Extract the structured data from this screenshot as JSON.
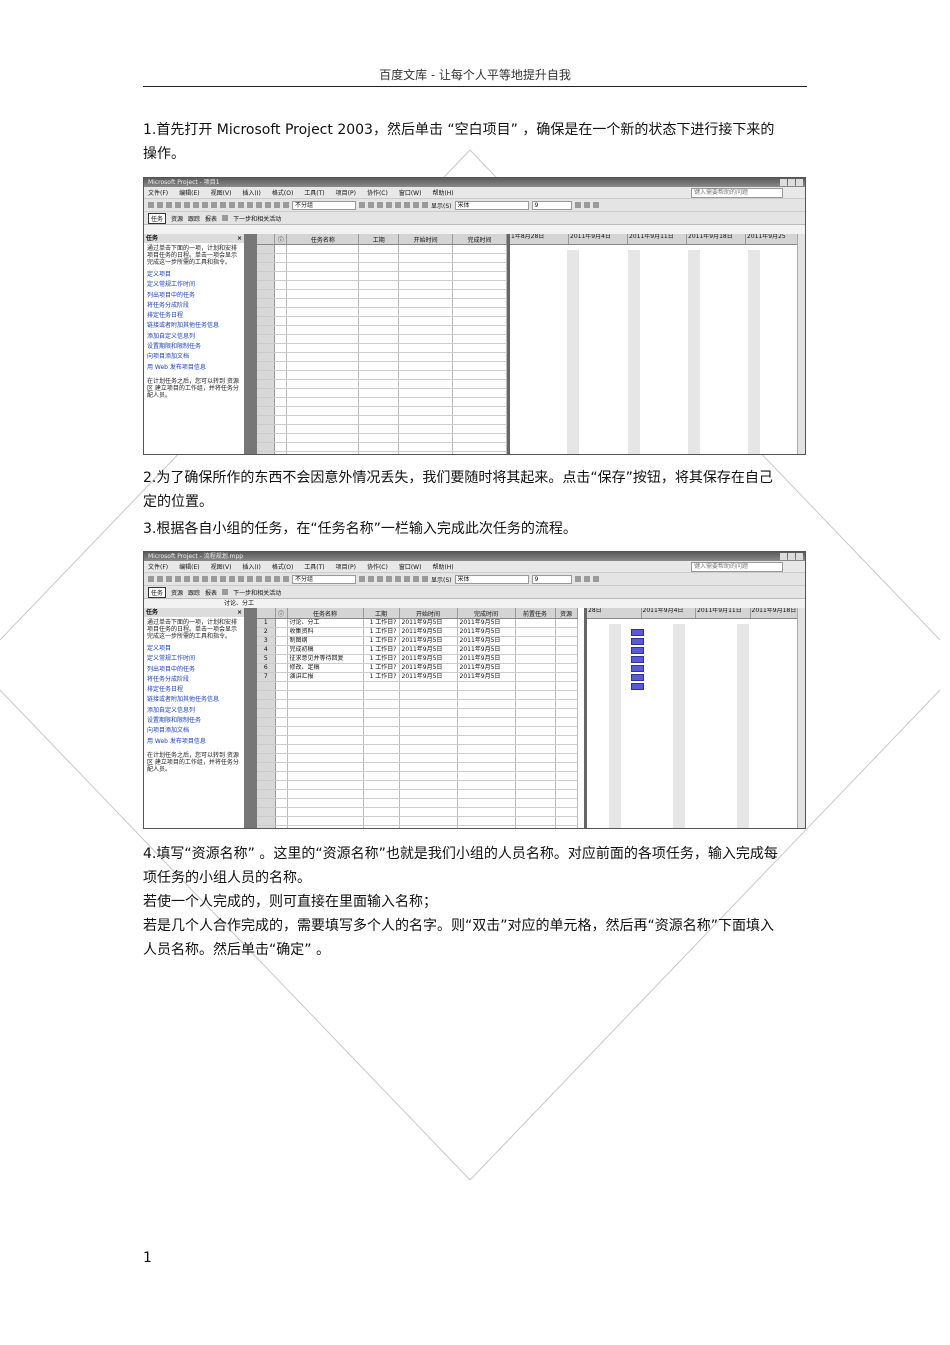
{
  "header": {
    "text": "百度文库  - 让每个人平等地提升自我"
  },
  "paragraphs": {
    "p1": "1.首先打开   Microsoft Project 2003，然后单击 “空白项目” ，确保是在一个新的状态下进行接下来的操作。",
    "p2": "2.为了确保所作的东西不会因意外情况丢失，我们要随时将其起来。点击“保存”按钮，将其保存在自己定的位置。",
    "p3": "3.根据各自小组的任务，在“任务名称”一栏输入完成此次任务的流程。",
    "p4": "4.填写“资源名称”  。这里的“资源名称”也就是我们小组的人员名称。对应前面的各项任务，输入完成每项任务的小组人员的名称。",
    "p5": "若使一个人完成的，则可直接在里面输入名称；",
    "p6": "若是几个人合作完成的，需要填写多个人的名字。则“双击”对应的单元格，然后再“资源名称”下面填入人员名称。然后单击“确定”    。"
  },
  "page_number": "1",
  "shot1": {
    "title": "Microsoft Project - 项目1",
    "menus": [
      "文件(F)",
      "编辑(E)",
      "视图(V)",
      "插入(I)",
      "格式(O)",
      "工具(T)",
      "项目(P)",
      "协作(C)",
      "窗口(W)",
      "帮助(H)"
    ],
    "help_placeholder": "键入需要帮助的问题",
    "group_combo": "不分组",
    "show_label": "显示(S)",
    "font_combo": "宋体",
    "size_combo": "9",
    "subbar": [
      "任务",
      "资源",
      "跟踪",
      "报表"
    ],
    "next_steps": "下一步和相关活动",
    "pane_title": "任务",
    "pane_intro": "通过单击下面的一项，计划和安排项目任务的日程。单击一项会显示完成这一步所需的工具和指令。",
    "pane_links": [
      "定义项目",
      "定义常规工作时间",
      "列出项目中的任务",
      "将任务分成阶段",
      "排定任务日程",
      "链接或者附加其他任务信息",
      "添加自定义信息列",
      "设置期限和限制任务",
      "向项目添加文档",
      "用 Web 发布项目信息"
    ],
    "pane_foot": "在计划任务之后，您可以转到 资源区 建立项目的工作组，并将任务分配人员。",
    "columns": [
      "任务名称",
      "工期",
      "开始时间",
      "完成时间"
    ],
    "gantt_weeks": [
      "1年8月28日",
      "2011年9月4日",
      "2011年9月11日",
      "2011年9月18日",
      "2011年9月25"
    ]
  },
  "shot2": {
    "title": "Microsoft Project - 流程规划.mpp",
    "menus": [
      "文件(F)",
      "编辑(E)",
      "视图(V)",
      "插入(I)",
      "格式(O)",
      "工具(T)",
      "项目(P)",
      "协作(C)",
      "窗口(W)",
      "帮助(H)"
    ],
    "help_placeholder": "键入需要帮助的问题",
    "group_combo": "不分组",
    "show_label": "显示(S)",
    "font_combo": "宋体",
    "size_combo": "9",
    "subbar": [
      "任务",
      "资源",
      "跟踪",
      "报表"
    ],
    "next_steps": "下一步和相关活动",
    "entry_text": "讨论、分工",
    "pane_title": "任务",
    "pane_intro": "通过单击下面的一项，计划和安排项目任务的日程。单击一项会显示完成这一步所需的工具和指令。",
    "pane_links": [
      "定义项目",
      "定义常规工作时间",
      "列出项目中的任务",
      "将任务分成阶段",
      "排定任务日程",
      "链接或者附加其他任务信息",
      "添加自定义信息列",
      "设置期限和限制任务",
      "向项目添加文档",
      "用 Web 发布项目信息"
    ],
    "pane_foot": "在计划任务之后，您可以转到 资源区 建立项目的工作组，并将任务分配人员。",
    "columns": [
      "任务名称",
      "工期",
      "开始时间",
      "完成时间",
      "前置任务",
      "资源"
    ],
    "tasks": [
      {
        "id": "1",
        "name": "讨论、分工",
        "duration": "1 工作日?",
        "start": "2011年9月5日",
        "finish": "2011年9月5日"
      },
      {
        "id": "2",
        "name": "收集资料",
        "duration": "1 工作日?",
        "start": "2011年9月5日",
        "finish": "2011年9月5日"
      },
      {
        "id": "3",
        "name": "制图纲",
        "duration": "1 工作日?",
        "start": "2011年9月5日",
        "finish": "2011年9月5日"
      },
      {
        "id": "4",
        "name": "完成初稿",
        "duration": "1 工作日?",
        "start": "2011年9月5日",
        "finish": "2011年9月5日"
      },
      {
        "id": "5",
        "name": "征求意见并等待回复",
        "duration": "1 工作日?",
        "start": "2011年9月5日",
        "finish": "2011年9月5日"
      },
      {
        "id": "6",
        "name": "修改、定稿",
        "duration": "1 工作日?",
        "start": "2011年9月5日",
        "finish": "2011年9月5日"
      },
      {
        "id": "7",
        "name": "演讲汇报",
        "duration": "1 工作日?",
        "start": "2011年9月5日",
        "finish": "2011年9月5日"
      }
    ],
    "gantt_weeks": [
      "28日",
      "2011年9月4日",
      "2011年9月11日",
      "2011年9月18日"
    ]
  }
}
